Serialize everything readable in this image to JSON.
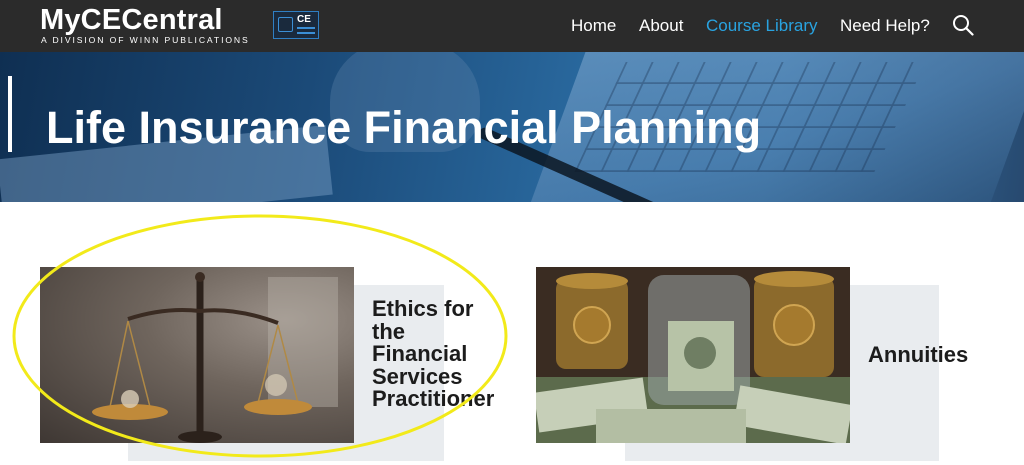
{
  "header": {
    "logo_main": "MyCECentral",
    "logo_sub": "A DIVISION OF WINN PUBLICATIONS",
    "badge_text": "CE",
    "nav": [
      {
        "label": "Home",
        "active": false
      },
      {
        "label": "About",
        "active": false
      },
      {
        "label": "Course Library",
        "active": true
      },
      {
        "label": "Need Help?",
        "active": false
      }
    ],
    "search_icon": "search-icon",
    "active_color": "#29a3e0",
    "bg_color": "#2b2b2b"
  },
  "hero": {
    "title": "Life Insurance Financial Planning"
  },
  "courses": [
    {
      "title_lines": [
        "Ethics for",
        "the",
        "Financial",
        "Services",
        "Practitioner"
      ],
      "image": "balance-scales-image",
      "highlighted": true
    },
    {
      "title_lines": [
        "Annuities"
      ],
      "image": "money-jars-image",
      "highlighted": false
    }
  ],
  "annotation_color": "#f2ea1a"
}
